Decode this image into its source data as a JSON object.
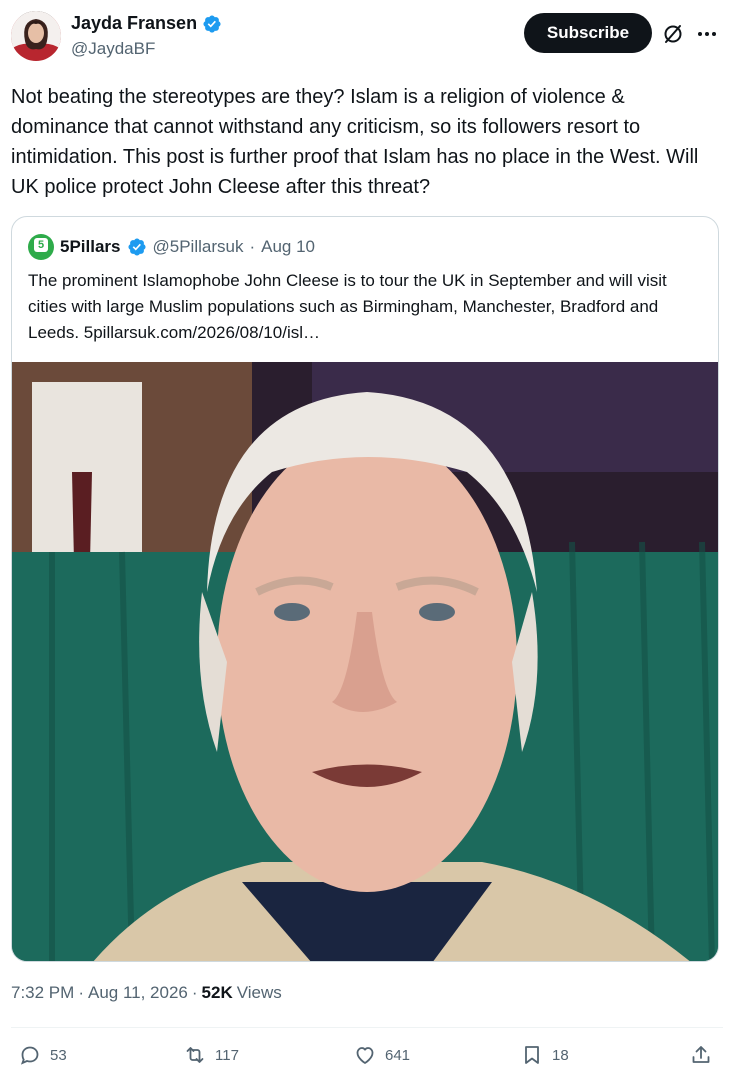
{
  "author": {
    "display_name": "Jayda Fransen",
    "handle": "@JaydaBF",
    "verified_icon": "verified-badge-icon"
  },
  "header": {
    "subscribe_label": "Subscribe",
    "grok_icon": "grok-icon",
    "more_icon": "more-icon"
  },
  "tweet": {
    "text": "Not beating the stereotypes are they? Islam is a religion of violence & dominance that cannot withstand any criticism, so its followers resort to intimidation. This post is further proof that Islam has no place in the West. Will UK police protect John Cleese after this threat?"
  },
  "quote": {
    "logo_glyph": "5",
    "display_name": "5Pillars",
    "handle": "@5Pillarsuk",
    "separator": "·",
    "date": "Aug 10",
    "text": "The prominent Islamophobe John Cleese is to tour the UK in September and will visit cities with large Muslim populations such as Birmingham, Manchester, Bradford and Leeds. 5pillarsuk.com/2026/08/10/isl…"
  },
  "meta": {
    "time": "7:32 PM",
    "sep1": "·",
    "date": "Aug 11, 2026",
    "sep2": "·",
    "views_count": "52K",
    "views_label": "Views"
  },
  "actions": {
    "replies": "53",
    "reposts": "117",
    "likes": "641",
    "bookmarks": "18"
  },
  "colors": {
    "accent_blue": "#1d9bf0",
    "text_primary": "#0f1419",
    "text_secondary": "#536471",
    "border": "#cfd9de",
    "logo_green": "#2eab4a"
  }
}
